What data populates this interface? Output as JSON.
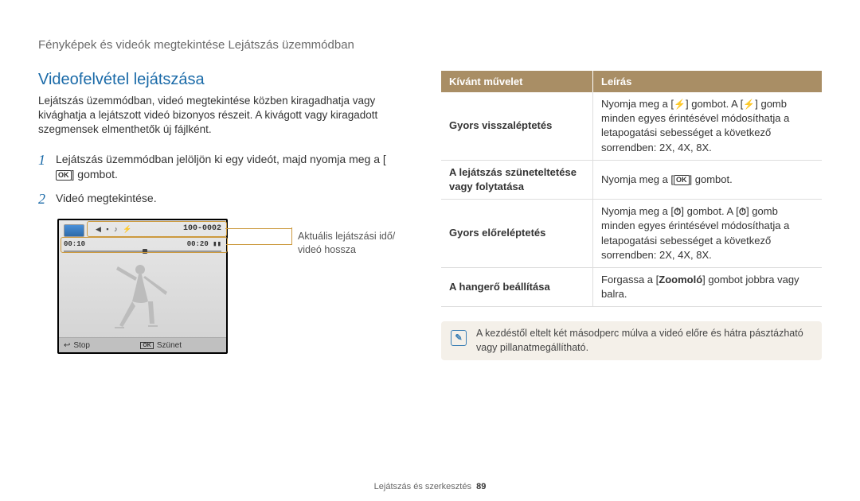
{
  "header": "Fényképek és videók megtekintése Lejátszás üzemmódban",
  "section_title": "Videofelvétel lejátszása",
  "intro": "Lejátszás üzemmódban, videó megtekintése közben kiragadhatja vagy kivághatja a lejátszott videó bizonyos részeit. A kivágott vagy kiragadott szegmensek elmenthetők új fájlként.",
  "steps": [
    {
      "num": "1",
      "before_icon": "Lejátszás üzemmódban jelöljön ki egy videót, majd nyomja meg a [",
      "icon": "OK",
      "after_icon": "] gombot."
    },
    {
      "num": "2",
      "before_icon": "Videó megtekintése.",
      "icon": "",
      "after_icon": ""
    }
  ],
  "camera": {
    "counter": "100-0002",
    "elapsed": "00:10",
    "total": "00:20",
    "stop": "Stop",
    "pause": "Szünet",
    "ok": "OK",
    "battery": "▮▮"
  },
  "caption": "Aktuális lejátszási idő/\nvideó hossza",
  "table": {
    "headers": [
      "Kívánt művelet",
      "Leírás"
    ],
    "rows": [
      {
        "op": "Gyors visszaléptetés",
        "desc_parts": [
          "Nyomja meg a [",
          "⚡",
          "] gombot. A [",
          "⚡",
          "] gomb minden egyes érintésével módosíthatja a letapogatási sebességet a következő sorrendben: 2X, 4X, 8X."
        ]
      },
      {
        "op": "A lejátszás szüneteltetése vagy folytatása",
        "desc_parts": [
          "Nyomja meg a [",
          "OK",
          "] gombot."
        ]
      },
      {
        "op": "Gyors előreléptetés",
        "desc_parts": [
          "Nyomja meg a [",
          "⏱",
          "] gombot. A [",
          "⏱",
          "] gomb minden egyes érintésével módosíthatja a letapogatási sebességet a következő sorrendben: 2X, 4X, 8X."
        ]
      },
      {
        "op": "A hangerő beállítása",
        "desc_parts": [
          "Forgassa a [",
          "Zoomoló",
          "] gombot jobbra vagy balra."
        ]
      }
    ]
  },
  "note": "A kezdéstől eltelt két másodperc múlva a videó előre és hátra pásztázható vagy pillanatmegállítható.",
  "footer_text": "Lejátszás és szerkesztés",
  "page_number": "89"
}
